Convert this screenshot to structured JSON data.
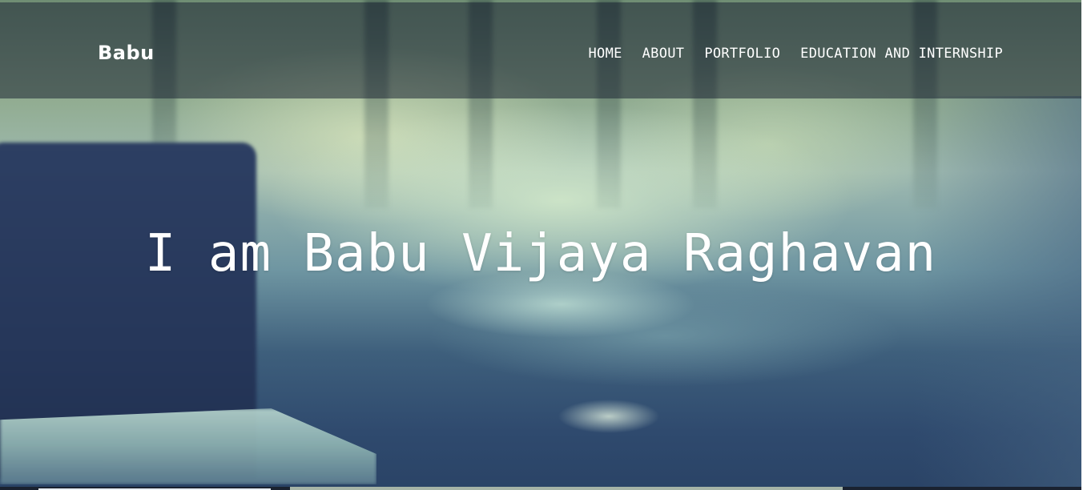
{
  "brand": {
    "name": "Babu"
  },
  "nav": {
    "items": [
      {
        "label": "HOME"
      },
      {
        "label": "ABOUT"
      },
      {
        "label": "PORTFOLIO"
      },
      {
        "label": "EDUCATION AND INTERNSHIP"
      }
    ]
  },
  "hero": {
    "headline": "I am Babu Vijaya Raghavan"
  },
  "colors": {
    "navbar_overlay": "#1e2634",
    "text": "#ffffff",
    "hero_dark": "#2a4366",
    "hero_light": "#d6ecd0"
  }
}
